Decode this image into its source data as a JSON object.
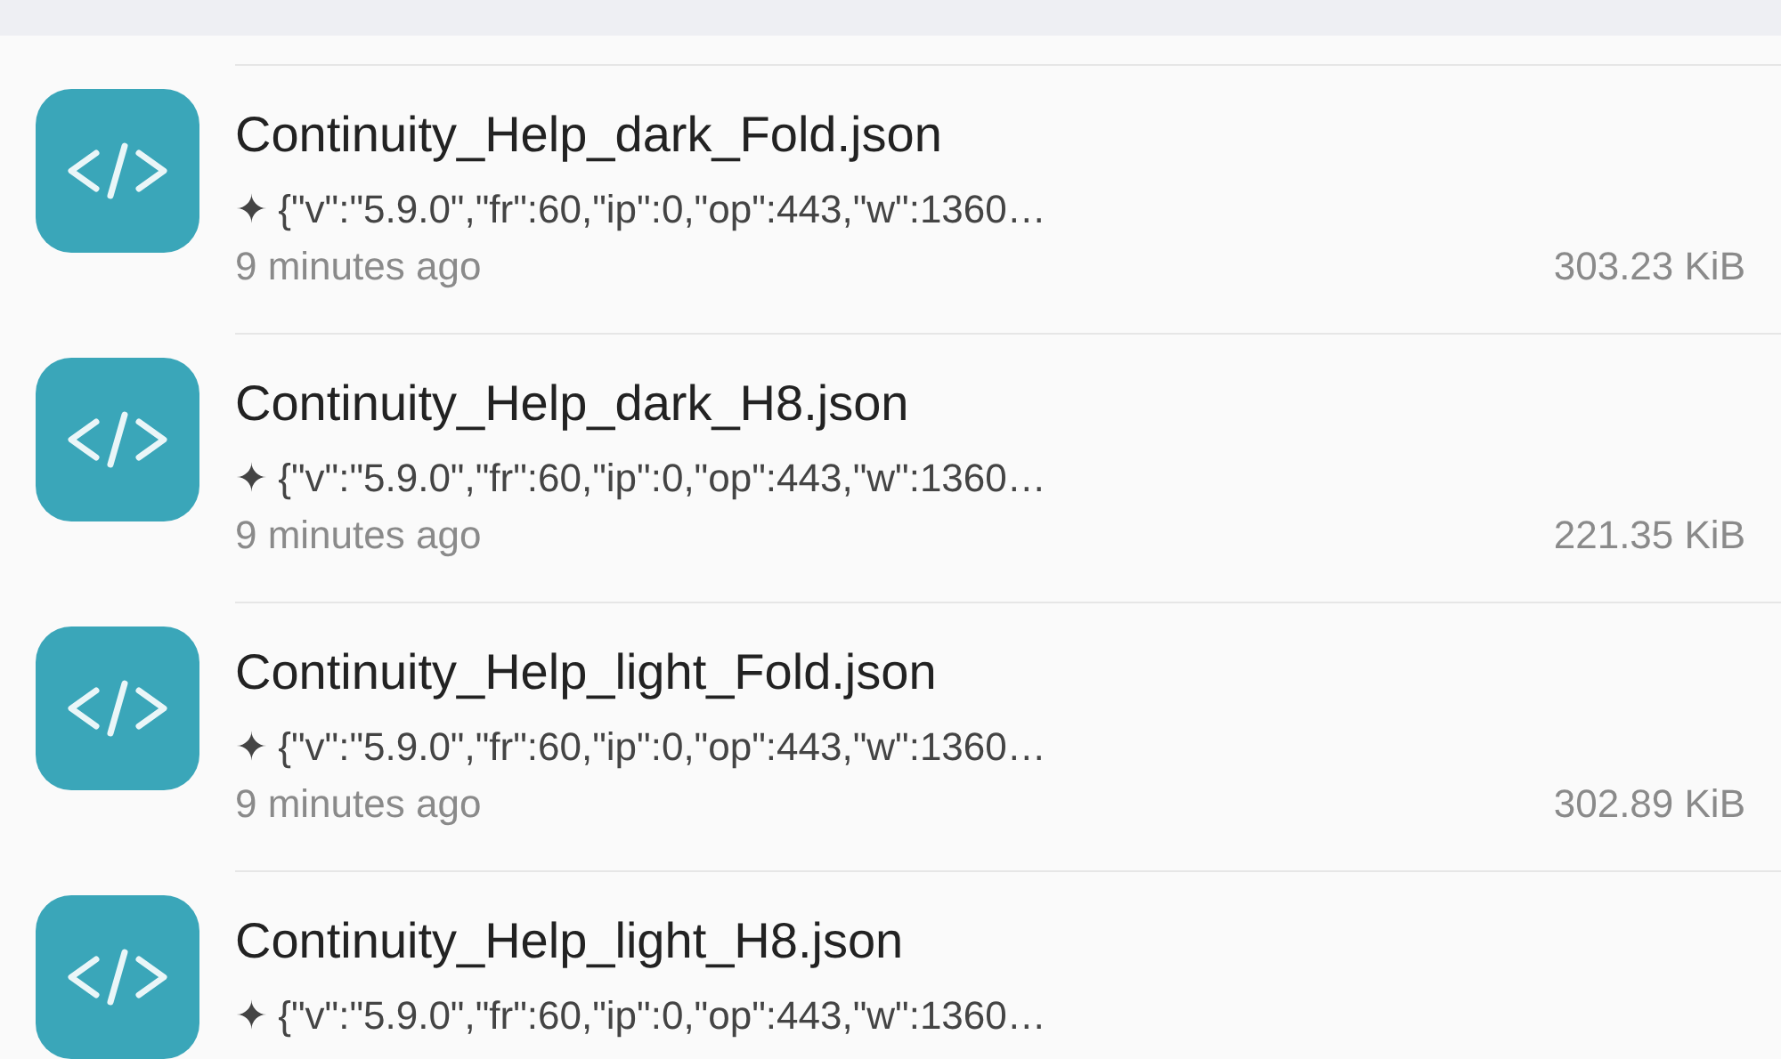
{
  "files": [
    {
      "name": "Continuity_Help_dark_Fold.json",
      "preview": "✦ {\"v\":\"5.9.0\",\"fr\":60,\"ip\":0,\"op\":443,\"w\":1360…",
      "time": "9 minutes ago",
      "size": "303.23  KiB"
    },
    {
      "name": "Continuity_Help_dark_H8.json",
      "preview": "✦ {\"v\":\"5.9.0\",\"fr\":60,\"ip\":0,\"op\":443,\"w\":1360…",
      "time": "9 minutes ago",
      "size": "221.35  KiB"
    },
    {
      "name": "Continuity_Help_light_Fold.json",
      "preview": "✦ {\"v\":\"5.9.0\",\"fr\":60,\"ip\":0,\"op\":443,\"w\":1360…",
      "time": "9 minutes ago",
      "size": "302.89  KiB"
    },
    {
      "name": "Continuity_Help_light_H8.json",
      "preview": "✦ {\"v\":\"5.9.0\",\"fr\":60,\"ip\":0,\"op\":443,\"w\":1360…"
    }
  ]
}
